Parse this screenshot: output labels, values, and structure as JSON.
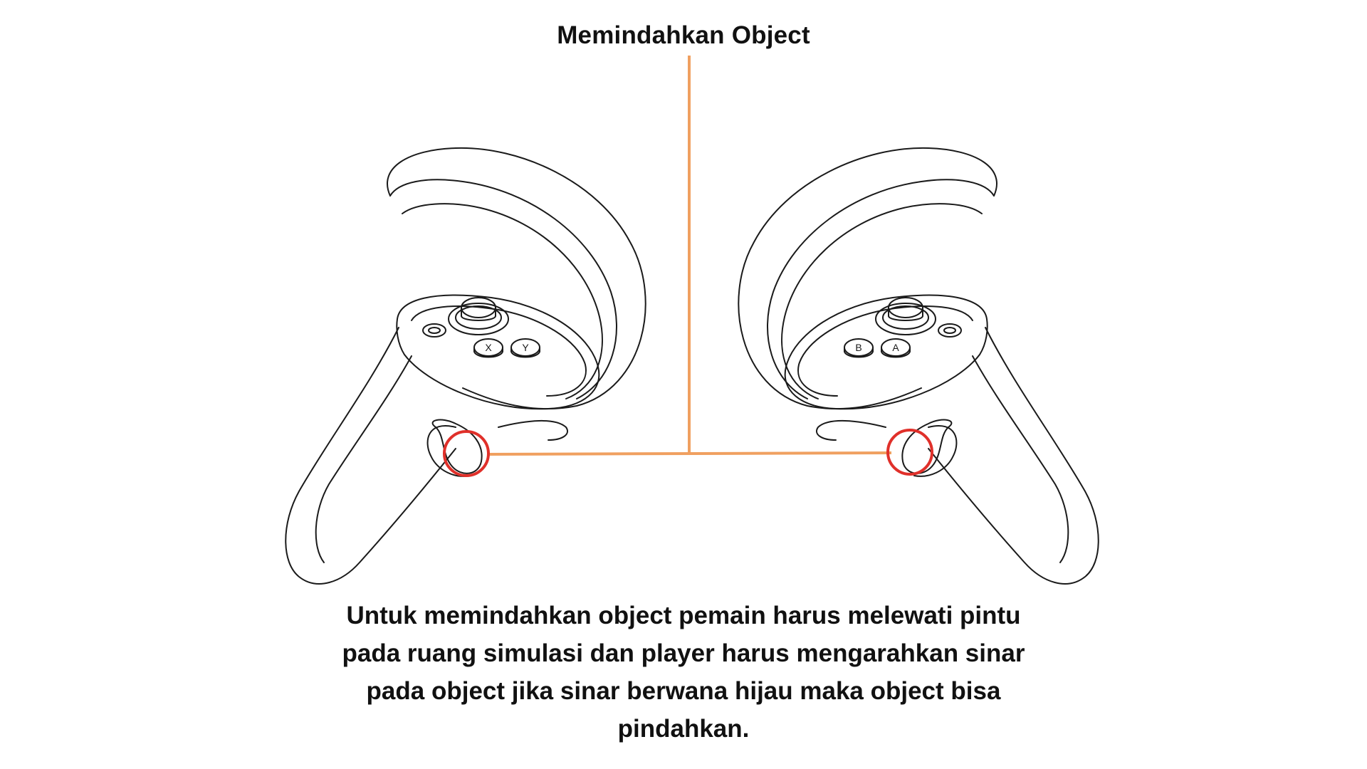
{
  "title": "Memindahkan Object",
  "caption_lines": [
    "Untuk memindahkan object pemain harus melewati pintu",
    "pada ruang simulasi dan player harus mengarahkan sinar",
    "pada object jika sinar berwana hijau maka object bisa",
    "pindahkan."
  ],
  "left_controller": {
    "button_labels": [
      "X",
      "Y"
    ],
    "menu_button_icon": "menu-icon"
  },
  "right_controller": {
    "button_labels": [
      "B",
      "A"
    ],
    "home_button_icon": "oculus-icon"
  },
  "colors": {
    "connector": "#f0a060",
    "highlight": "#e0302a",
    "outline": "#1a1a1a",
    "text": "#111111"
  }
}
